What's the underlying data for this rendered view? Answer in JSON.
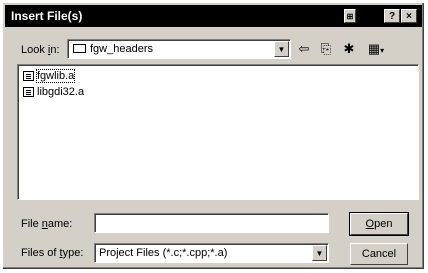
{
  "window": {
    "title": "Insert File(s)",
    "help_label": "?",
    "close_label": "×"
  },
  "lookin": {
    "label_pre": "Look ",
    "label_key": "i",
    "label_post": "n:",
    "value": "fgw_headers"
  },
  "toolbar": {
    "back_icon": "⇦",
    "up_icon": "⎘",
    "newfolder_icon": "✱",
    "view_icon": "▦"
  },
  "files": [
    {
      "name": "fgwlib.a"
    },
    {
      "name": "libgdi32.a"
    }
  ],
  "filename": {
    "label_pre": "File ",
    "label_key": "n",
    "label_post": "ame:",
    "value": ""
  },
  "filetype": {
    "label_pre": "Files of ",
    "label_key": "t",
    "label_post": "ype:",
    "value": "Project Files (*.c;*.cpp;*.a)"
  },
  "buttons": {
    "open_key": "O",
    "open_rest": "pen",
    "cancel_label": "Cancel"
  }
}
